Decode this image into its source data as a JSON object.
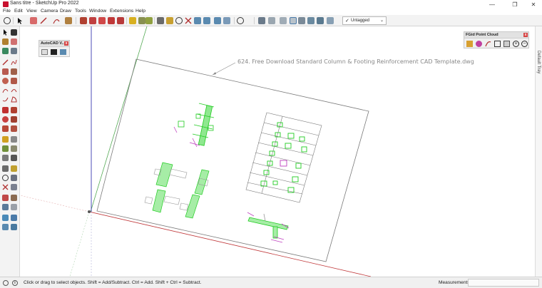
{
  "window": {
    "title": "Sans titre - SketchUp Pro 2022",
    "minimize": "—",
    "maximize": "❐",
    "close": "✕"
  },
  "menu": [
    "File",
    "Edit",
    "View",
    "Camera",
    "Draw",
    "Tools",
    "Window",
    "Extensions",
    "Help"
  ],
  "toolbar": {
    "tag_value": "Untagged",
    "tag_check": "✓",
    "tag_arrow": "⌄"
  },
  "panels": {
    "autocad": {
      "title": "AutoCAD V...",
      "close": "x"
    },
    "pointcloud": {
      "title": "FGid Point Cloud",
      "close": "x"
    }
  },
  "right_tray": {
    "label": "Default Tray"
  },
  "canvas": {
    "drawing_title": "624. Free Download Standard Column & Footing Reinforcement CAD Template.dwg"
  },
  "status": {
    "hint": "Click or drag to select objects. Shift = Add/Subtract. Ctrl = Add. Shift + Ctrl = Subtract.",
    "measurements_label": "Measurements",
    "measurements_value": ""
  },
  "colors": {
    "axis_red": "#c0383a",
    "axis_green": "#55aa55",
    "axis_blue": "#3a3ab0",
    "cad_green": "#22cc22",
    "cad_magenta": "#c040c0",
    "sheet_border": "#7a7a7a"
  }
}
